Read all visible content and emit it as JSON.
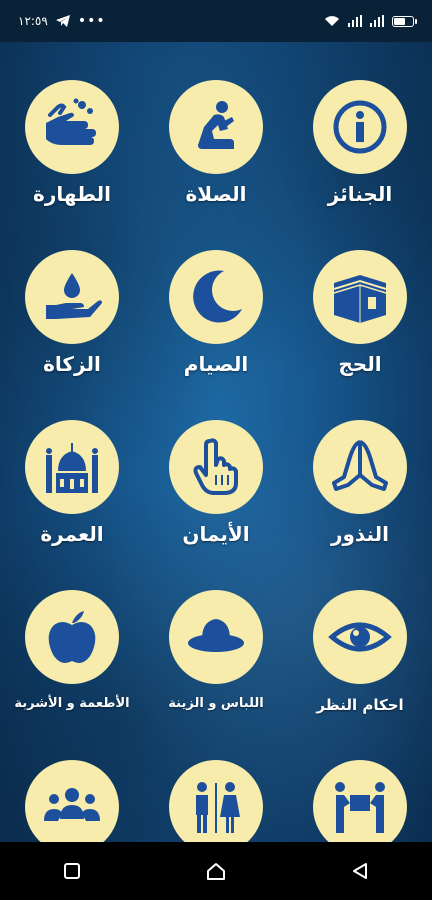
{
  "status_bar": {
    "time": "١٢:٥٩",
    "dots": "•••"
  },
  "tiles": [
    {
      "label": "الطهارة"
    },
    {
      "label": "الصلاة"
    },
    {
      "label": "الجنائز"
    },
    {
      "label": "الزكاة"
    },
    {
      "label": "الصيام"
    },
    {
      "label": "الحج"
    },
    {
      "label": "العمرة"
    },
    {
      "label": "الأيمان"
    },
    {
      "label": "النذور"
    },
    {
      "label": "الأطعمة و الأشربة"
    },
    {
      "label": "اللباس و الزينة"
    },
    {
      "label": "احكام النظر"
    }
  ],
  "colors": {
    "circle": "#f7ecab",
    "icon": "#1c4f9c",
    "background": "#17568c"
  }
}
